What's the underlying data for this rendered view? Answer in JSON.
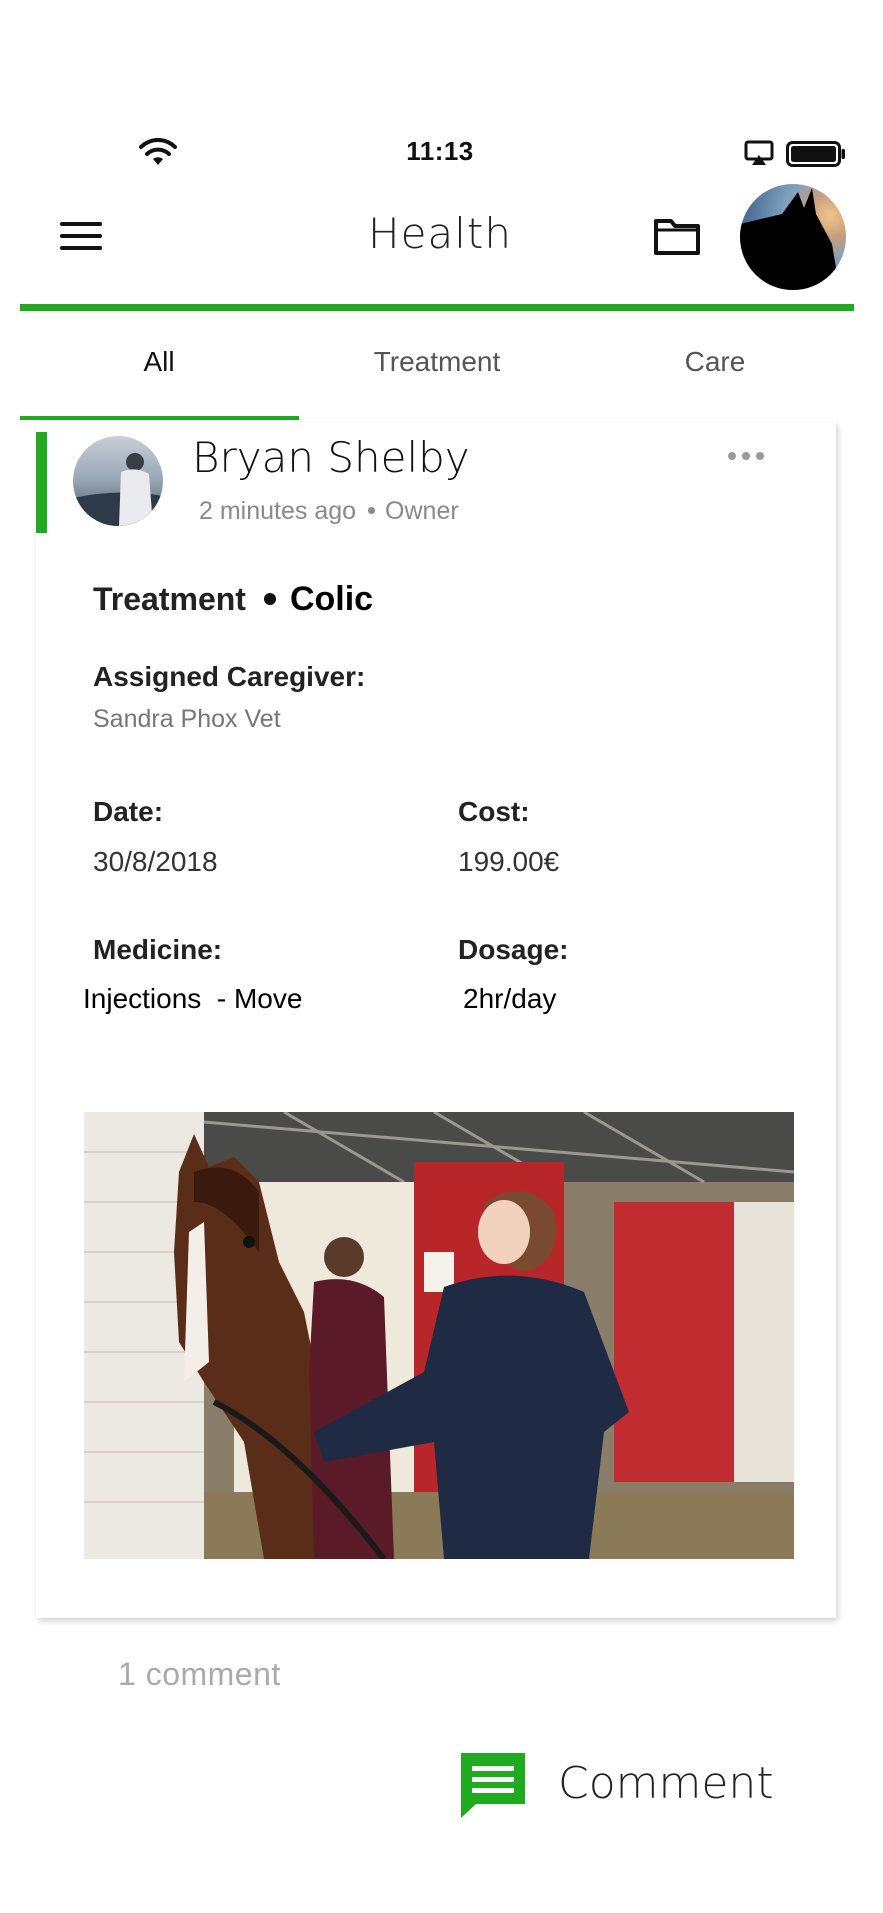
{
  "status_bar": {
    "time": "11:13",
    "icons": [
      "wifi-icon",
      "airplay-icon",
      "battery-icon"
    ]
  },
  "header": {
    "title": "Health",
    "accent_color": "#1faa1f"
  },
  "tabs": [
    {
      "label": "All",
      "active": true
    },
    {
      "label": "Treatment",
      "active": false
    },
    {
      "label": "Care",
      "active": false
    }
  ],
  "post": {
    "author": "Bryan Shelby",
    "time_ago": "2 minutes ago",
    "role": "Owner",
    "category": "Treatment",
    "subcategory": "Colic",
    "fields": {
      "assigned_caregiver_label": "Assigned Caregiver:",
      "assigned_caregiver": "Sandra Phox Vet",
      "date_label": "Date:",
      "date": "30/8/2018",
      "cost_label": "Cost:",
      "cost": "199.00€",
      "medicine_label": "Medicine:",
      "medicine": "Injections  - Move",
      "dosage_label": "Dosage:",
      "dosage": "2hr/day"
    }
  },
  "comments": {
    "count_text": "1 comment",
    "button_label": "Comment"
  }
}
